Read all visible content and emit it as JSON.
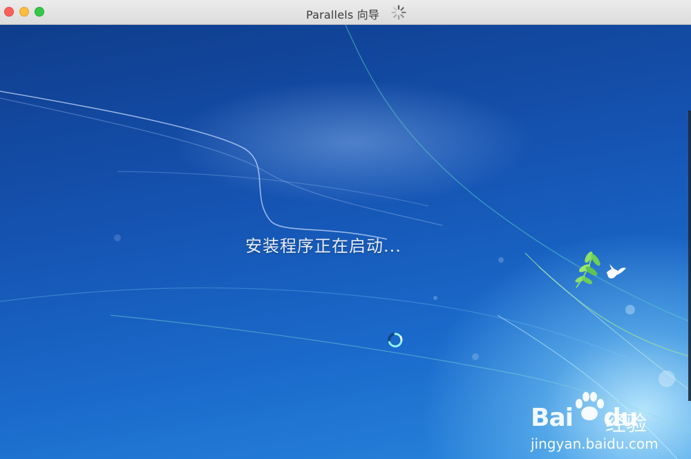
{
  "window": {
    "title": "Parallels 向导",
    "controls": {
      "close_icon": "close-circle-icon",
      "minimize_icon": "minimize-circle-icon",
      "zoom_icon": "zoom-circle-icon"
    },
    "busy_icon": "spinner-icon"
  },
  "setup_screen": {
    "status_text": "安装程序正在启动...",
    "loader_icon": "loading-ring-icon",
    "decoration_icon": "dove-branch-icon"
  },
  "watermark": {
    "logo_text": "Bai",
    "logo_text_tail": "du",
    "sub_text": "经验",
    "url": "jingyan.baidu.com",
    "paw_icon": "paw-icon"
  },
  "colors": {
    "close": "#fc605c",
    "minimize": "#fdbc40",
    "zoom": "#34c84a",
    "screen_blue": "#1552b0"
  }
}
